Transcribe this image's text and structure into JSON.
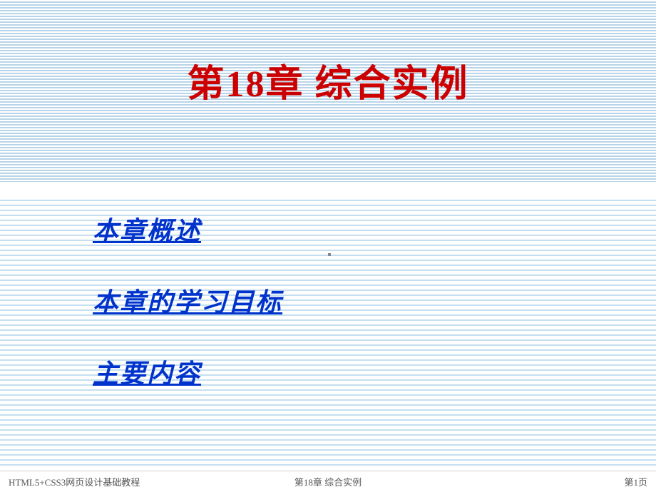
{
  "slide": {
    "title": "第18章  综合实例",
    "links": {
      "overview": "本章概述",
      "objectives": "本章的学习目标",
      "contents": "主要内容"
    }
  },
  "footer": {
    "left": "HTML5+CSS3网页设计基础教程",
    "center": "第18章  综合实例",
    "right": "第1页"
  }
}
